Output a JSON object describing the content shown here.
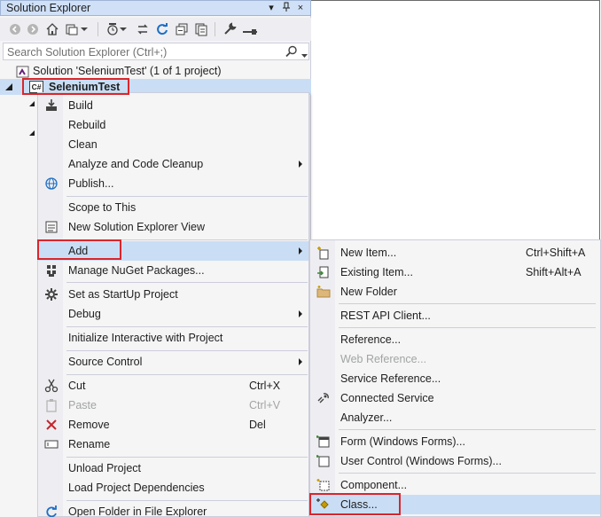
{
  "panel": {
    "title": "Solution Explorer",
    "title_buttons": [
      "▾",
      "ꟾ",
      "×"
    ],
    "search_placeholder": "Search Solution Explorer (Ctrl+;)"
  },
  "tree": {
    "solution_label": "Solution 'SeleniumTest' (1 of 1 project)",
    "project_label": "SeleniumTest",
    "project_badge": "C#"
  },
  "context_menu": {
    "items": [
      {
        "label": "Build",
        "icon": "build-icon"
      },
      {
        "label": "Rebuild"
      },
      {
        "label": "Clean"
      },
      {
        "label": "Analyze and Code Cleanup",
        "submenu": true
      },
      {
        "label": "Publish...",
        "icon": "publish-globe-icon"
      },
      {
        "label": "Scope to This"
      },
      {
        "label": "New Solution Explorer View",
        "icon": "new-view-icon"
      },
      {
        "label": "Add",
        "submenu": true
      },
      {
        "label": "Manage NuGet Packages...",
        "icon": "nuget-icon"
      },
      {
        "label": "Set as StartUp Project",
        "icon": "gear-icon"
      },
      {
        "label": "Debug",
        "submenu": true
      },
      {
        "label": "Initialize Interactive with Project"
      },
      {
        "label": "Source Control",
        "submenu": true
      },
      {
        "label": "Cut",
        "shortcut": "Ctrl+X",
        "icon": "scissors-icon"
      },
      {
        "label": "Paste",
        "shortcut": "Ctrl+V",
        "icon": "paste-icon",
        "disabled": true
      },
      {
        "label": "Remove",
        "shortcut": "Del",
        "icon": "remove-x-icon"
      },
      {
        "label": "Rename",
        "icon": "rename-icon"
      },
      {
        "label": "Unload Project"
      },
      {
        "label": "Load Project Dependencies"
      },
      {
        "label": "Open Folder in File Explorer",
        "icon": "open-folder-icon"
      }
    ]
  },
  "add_submenu": {
    "items": [
      {
        "label": "New Item...",
        "shortcut": "Ctrl+Shift+A",
        "icon": "new-item-icon"
      },
      {
        "label": "Existing Item...",
        "shortcut": "Shift+Alt+A",
        "icon": "existing-item-icon"
      },
      {
        "label": "New Folder",
        "icon": "new-folder-icon"
      },
      {
        "label": "REST API Client..."
      },
      {
        "label": "Reference..."
      },
      {
        "label": "Web Reference...",
        "disabled": true
      },
      {
        "label": "Service Reference..."
      },
      {
        "label": "Connected Service",
        "icon": "connected-service-icon"
      },
      {
        "label": "Analyzer..."
      },
      {
        "label": "Form (Windows Forms)...",
        "icon": "form-icon"
      },
      {
        "label": "User Control (Windows Forms)...",
        "icon": "user-control-icon"
      },
      {
        "label": "Component...",
        "icon": "component-icon"
      },
      {
        "label": "Class...",
        "icon": "class-icon"
      }
    ]
  },
  "colors": {
    "highlight": "#c9def5",
    "annotation_red": "#d9262c",
    "title_bar": "#cfe0f7"
  }
}
